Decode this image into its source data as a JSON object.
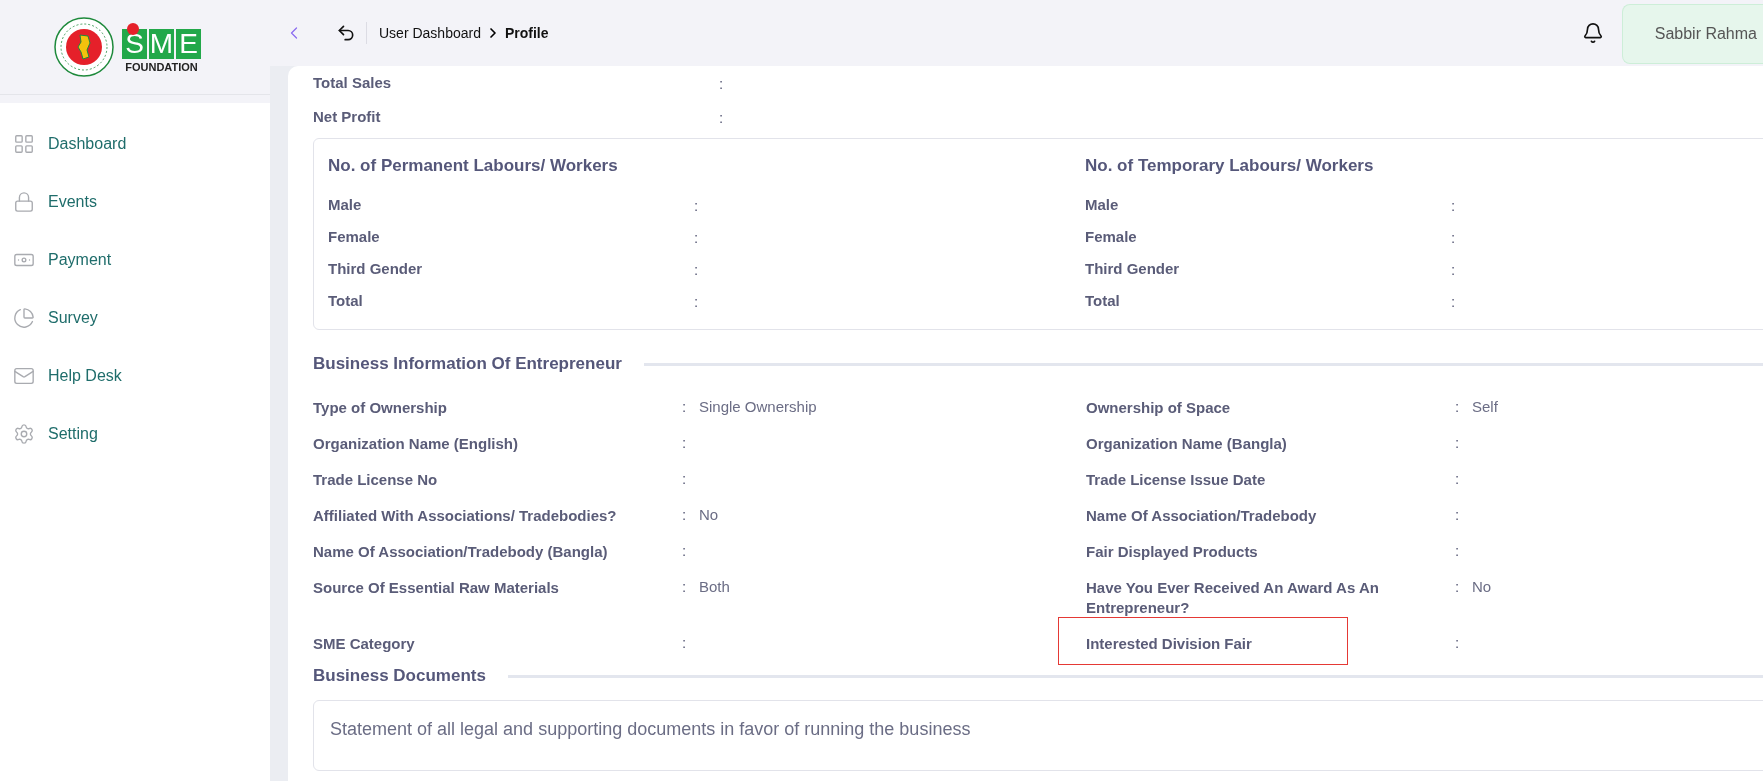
{
  "logo": {
    "letters": [
      "S",
      "M",
      "E"
    ],
    "subtitle": "FOUNDATION"
  },
  "header": {
    "breadcrumb": [
      {
        "label": "User Dashboard",
        "current": false
      },
      {
        "label": "Profile",
        "current": true
      }
    ],
    "user_name": "Sabbir Rahma"
  },
  "sidebar": {
    "items": [
      {
        "label": "Dashboard"
      },
      {
        "label": "Events"
      },
      {
        "label": "Payment"
      },
      {
        "label": "Survey"
      },
      {
        "label": "Help Desk"
      },
      {
        "label": "Setting"
      }
    ]
  },
  "summary_rows": [
    {
      "label": "Total Sales",
      "colon": ":"
    },
    {
      "label": "Net Profit",
      "colon": ":"
    }
  ],
  "labour_groups": [
    {
      "title": "No. of Permanent Labours/ Workers",
      "rows": [
        {
          "label": "Male",
          "colon": ":"
        },
        {
          "label": "Female",
          "colon": ":"
        },
        {
          "label": "Third Gender",
          "colon": ":"
        },
        {
          "label": "Total",
          "colon": ":"
        }
      ]
    },
    {
      "title": "No. of Temporary Labours/ Workers",
      "rows": [
        {
          "label": "Male",
          "colon": ":"
        },
        {
          "label": "Female",
          "colon": ":"
        },
        {
          "label": "Third Gender",
          "colon": ":"
        },
        {
          "label": "Total",
          "colon": ":"
        }
      ]
    }
  ],
  "business_info": {
    "title": "Business Information Of Entrepreneur",
    "fields": [
      {
        "label": "Type of Ownership",
        "colon": ":",
        "value": "Single Ownership",
        "highlighted": false
      },
      {
        "label": "Ownership of Space",
        "colon": ":",
        "value": "Self",
        "highlighted": false
      },
      {
        "label": "Organization Name (English)",
        "colon": ":",
        "highlighted": false
      },
      {
        "label": "Organization Name (Bangla)",
        "colon": ":",
        "highlighted": false
      },
      {
        "label": "Trade License No",
        "colon": ":",
        "highlighted": false
      },
      {
        "label": "Trade License Issue Date",
        "colon": ":",
        "highlighted": false
      },
      {
        "label": "Affiliated With Associations/ Tradebodies?",
        "colon": ":",
        "value": "No",
        "highlighted": false
      },
      {
        "label": "Name Of Association/Tradebody",
        "colon": ":",
        "highlighted": false
      },
      {
        "label": "Name Of Association/Tradebody (Bangla)",
        "colon": ":",
        "highlighted": false
      },
      {
        "label": "Fair Displayed Products",
        "colon": ":",
        "highlighted": false
      },
      {
        "label": "Source Of Essential Raw Materials",
        "colon": ":",
        "value": "Both",
        "highlighted": false
      },
      {
        "label": "Have You Ever Received An Award As An Entrepreneur?",
        "colon": ":",
        "value": "No",
        "highlighted": false
      },
      {
        "label": "SME Category",
        "colon": ":",
        "highlighted": false
      },
      {
        "label": "Interested Division Fair",
        "colon": ":",
        "highlighted": true
      }
    ]
  },
  "documents": {
    "title": "Business Documents",
    "statement": "Statement of all legal and supporting documents in favor of running the business"
  }
}
